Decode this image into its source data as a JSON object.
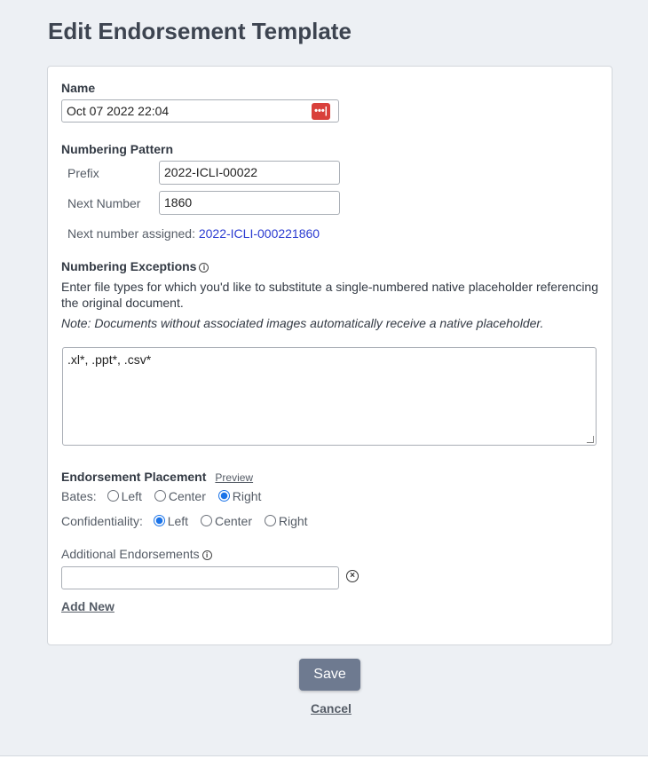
{
  "page": {
    "title": "Edit Endorsement Template"
  },
  "name_field": {
    "label": "Name",
    "value": "Oct 07 2022 22:04"
  },
  "numbering": {
    "heading": "Numbering Pattern",
    "prefix_label": "Prefix",
    "prefix_value": "2022-ICLI-00022",
    "next_number_label": "Next Number",
    "next_number_value": "1860",
    "assigned_label": "Next number assigned:",
    "assigned_value": "2022-ICLI-000221860"
  },
  "exceptions": {
    "heading": "Numbering Exceptions",
    "description": "Enter file types for which you'd like to substitute a single-numbered native placeholder referencing the original document.",
    "note": "Note: Documents without associated images automatically receive a native placeholder.",
    "value": ".xl*, .ppt*, .csv*"
  },
  "placement": {
    "heading": "Endorsement Placement",
    "preview_label": "Preview",
    "bates_label": "Bates:",
    "confidentiality_label": "Confidentiality:",
    "options": {
      "left": "Left",
      "center": "Center",
      "right": "Right"
    },
    "bates_selected": "Right",
    "confidentiality_selected": "Left"
  },
  "additional": {
    "label": "Additional Endorsements",
    "value": "",
    "add_new_label": "Add New"
  },
  "actions": {
    "save_label": "Save",
    "cancel_label": "Cancel"
  },
  "colors": {
    "accent": "#1a73e8",
    "link": "#2b3bd1",
    "save_bg": "#6e7a90",
    "password_icon": "#d9403b"
  }
}
